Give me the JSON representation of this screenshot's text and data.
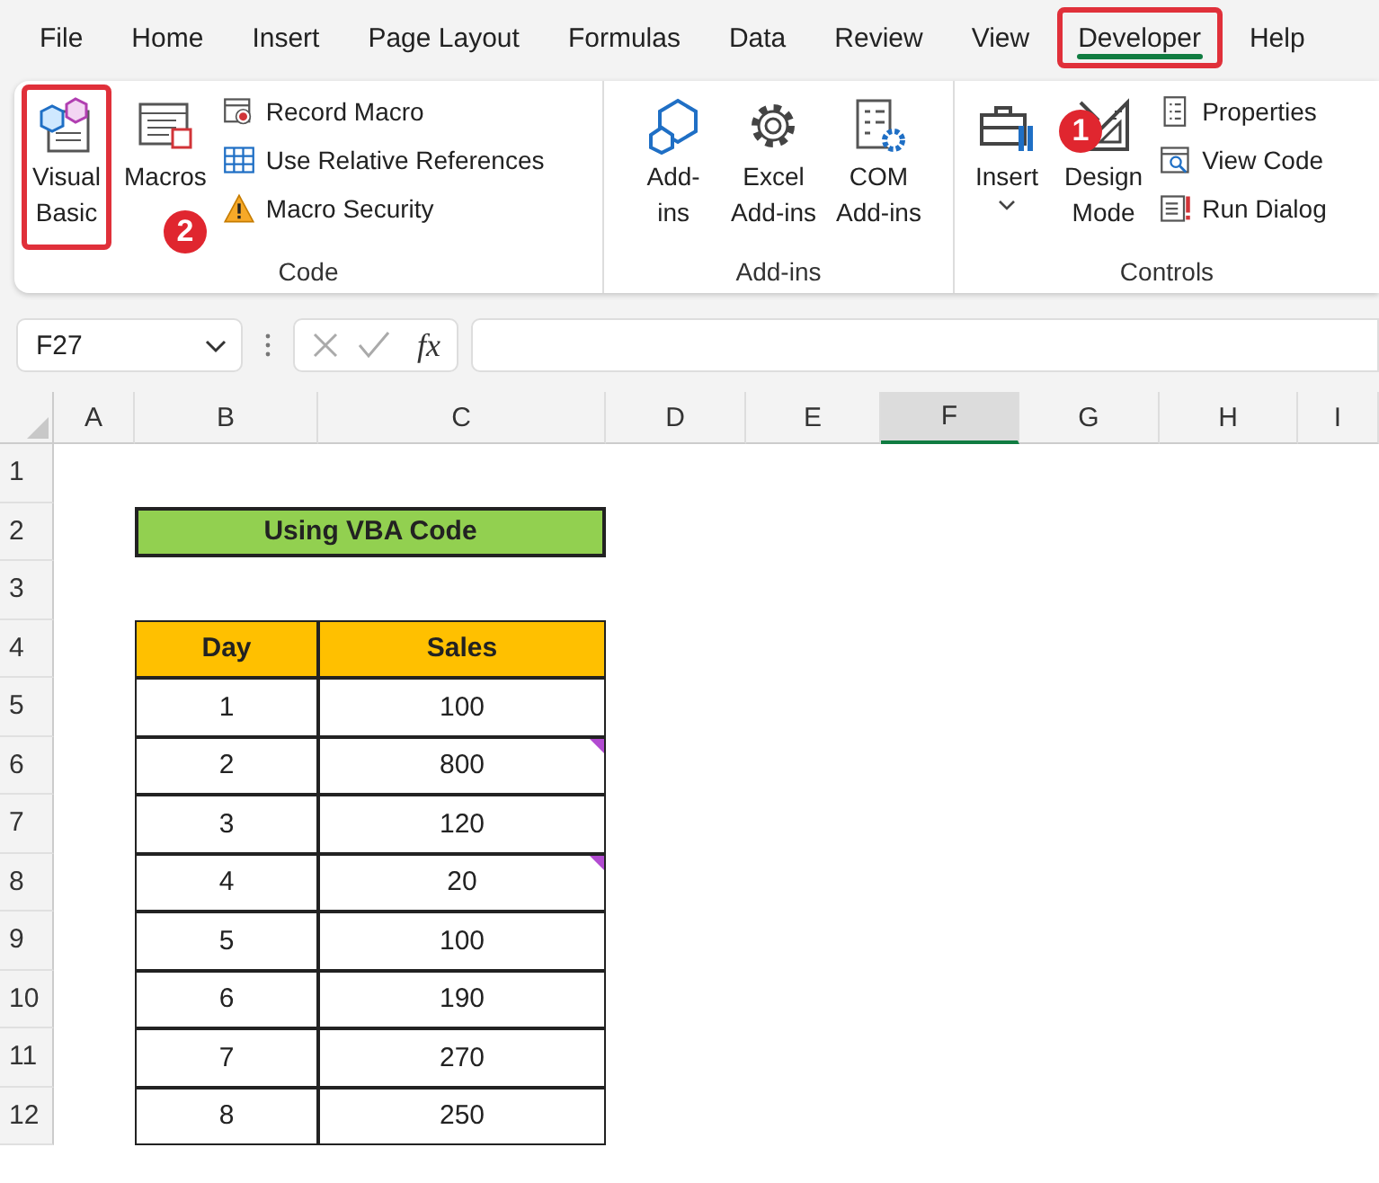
{
  "menu_tabs": [
    {
      "label": "File",
      "selected": false,
      "annotated": false
    },
    {
      "label": "Home",
      "selected": false,
      "annotated": false
    },
    {
      "label": "Insert",
      "selected": false,
      "annotated": false
    },
    {
      "label": "Page Layout",
      "selected": false,
      "annotated": false
    },
    {
      "label": "Formulas",
      "selected": false,
      "annotated": false
    },
    {
      "label": "Data",
      "selected": false,
      "annotated": false
    },
    {
      "label": "Review",
      "selected": false,
      "annotated": false
    },
    {
      "label": "View",
      "selected": false,
      "annotated": false
    },
    {
      "label": "Developer",
      "selected": true,
      "annotated": true
    },
    {
      "label": "Help",
      "selected": false,
      "annotated": false
    }
  ],
  "ribbon": {
    "groups": [
      {
        "label": "Code",
        "large": [
          {
            "lines": [
              "Visual",
              "Basic"
            ],
            "annotated": true,
            "dropdown": false
          },
          {
            "lines": [
              "Macros"
            ],
            "annotated": false,
            "dropdown": false
          }
        ],
        "small": [
          {
            "label": "Record Macro"
          },
          {
            "label": "Use Relative References"
          },
          {
            "label": "Macro Security"
          }
        ]
      },
      {
        "label": "Add-ins",
        "large": [
          {
            "lines": [
              "Add-",
              "ins"
            ],
            "annotated": false,
            "dropdown": false
          },
          {
            "lines": [
              "Excel",
              "Add-ins"
            ],
            "annotated": false,
            "dropdown": false
          },
          {
            "lines": [
              "COM",
              "Add-ins"
            ],
            "annotated": false,
            "dropdown": false
          }
        ]
      },
      {
        "label": "Controls",
        "large": [
          {
            "lines": [
              "Insert"
            ],
            "annotated": false,
            "dropdown": true
          },
          {
            "lines": [
              "Design",
              "Mode"
            ],
            "annotated": false,
            "dropdown": false
          }
        ],
        "small": [
          {
            "label": "Properties"
          },
          {
            "label": "View Code"
          },
          {
            "label": "Run Dialog"
          }
        ]
      }
    ]
  },
  "callouts": [
    {
      "label": "1"
    },
    {
      "label": "2"
    }
  ],
  "formula_bar": {
    "name_box": "F27",
    "function_button": "fx"
  },
  "sheet": {
    "columns": [
      {
        "label": "A",
        "selected": false
      },
      {
        "label": "B",
        "selected": false
      },
      {
        "label": "C",
        "selected": false
      },
      {
        "label": "D",
        "selected": false
      },
      {
        "label": "E",
        "selected": false
      },
      {
        "label": "F",
        "selected": true
      },
      {
        "label": "G",
        "selected": false
      },
      {
        "label": "H",
        "selected": false
      },
      {
        "label": "I",
        "selected": false
      }
    ],
    "rows": [
      "1",
      "2",
      "3",
      "4",
      "5",
      "6",
      "7",
      "8",
      "9",
      "10",
      "11",
      "12"
    ],
    "title": "Using VBA Code",
    "table": {
      "headers": [
        "Day",
        "Sales"
      ],
      "rows": [
        {
          "cells": [
            "1",
            "100"
          ],
          "comment": false
        },
        {
          "cells": [
            "2",
            "800"
          ],
          "comment": true
        },
        {
          "cells": [
            "3",
            "120"
          ],
          "comment": false
        },
        {
          "cells": [
            "4",
            "20"
          ],
          "comment": true
        },
        {
          "cells": [
            "5",
            "100"
          ],
          "comment": false
        },
        {
          "cells": [
            "6",
            "190"
          ],
          "comment": false
        },
        {
          "cells": [
            "7",
            "270"
          ],
          "comment": false
        },
        {
          "cells": [
            "8",
            "250"
          ],
          "comment": false
        }
      ]
    }
  }
}
